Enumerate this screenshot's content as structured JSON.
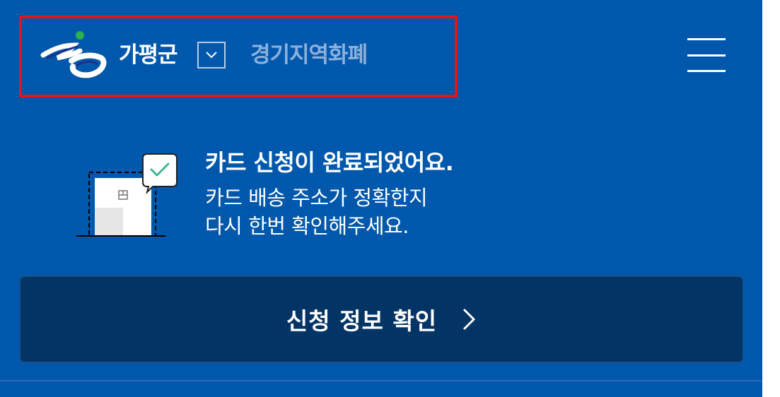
{
  "header": {
    "region": "가평군",
    "currency": "경기지역화폐"
  },
  "status": {
    "title": "카드 신청이 완료되었어요.",
    "line1": "카드 배송 주소가 정확한지",
    "line2": "다시 한번 확인해주세요."
  },
  "actions": {
    "confirm_label": "신청 정보 확인"
  },
  "icons": {
    "logo": "gapyeong-logo-icon",
    "dropdown": "chevron-down-icon",
    "menu": "hamburger-menu-icon",
    "card": "card-check-icon",
    "confirm": "chevron-right-icon"
  },
  "colors": {
    "background": "#0058ac",
    "button": "#023466",
    "highlight": "#e8121e",
    "currency_text": "#8cb0dc",
    "check": "#3db893"
  }
}
